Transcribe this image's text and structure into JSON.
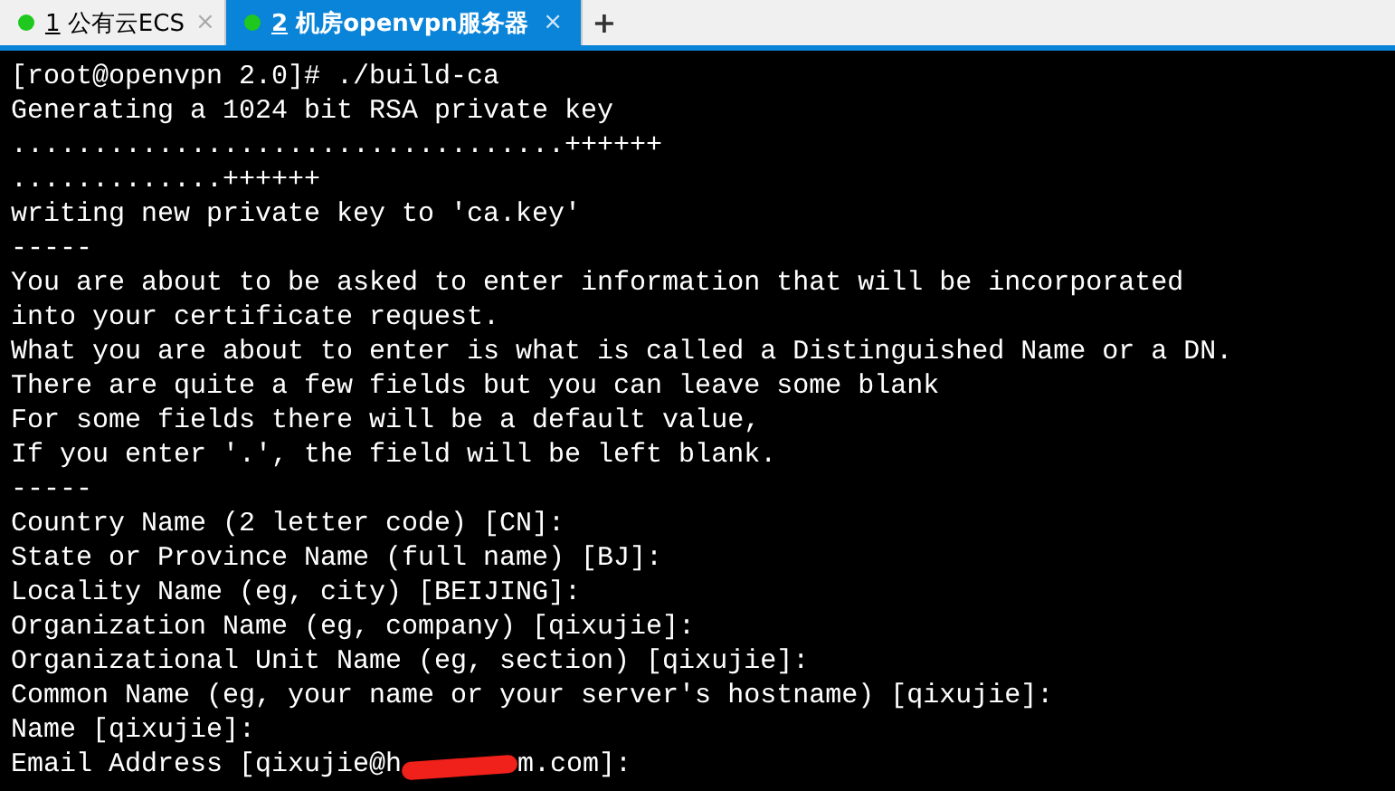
{
  "tabs": [
    {
      "number": "1",
      "label": "公有云ECS",
      "selected": false,
      "close": "×"
    },
    {
      "number": "2",
      "label": "机房openvpn服务器",
      "selected": true,
      "close": "×"
    }
  ],
  "new_tab": "+",
  "terminal": {
    "lines": [
      {
        "kind": "text",
        "text": "[root@openvpn 2.0]# ./build-ca"
      },
      {
        "kind": "text",
        "text": "Generating a 1024 bit RSA private key"
      },
      {
        "kind": "text",
        "text": "..................................++++++"
      },
      {
        "kind": "text",
        "text": ".............++++++"
      },
      {
        "kind": "text",
        "text": "writing new private key to 'ca.key'"
      },
      {
        "kind": "text",
        "text": "-----"
      },
      {
        "kind": "text",
        "text": "You are about to be asked to enter information that will be incorporated"
      },
      {
        "kind": "text",
        "text": "into your certificate request."
      },
      {
        "kind": "text",
        "text": "What you are about to enter is what is called a Distinguished Name or a DN."
      },
      {
        "kind": "text",
        "text": "There are quite a few fields but you can leave some blank"
      },
      {
        "kind": "text",
        "text": "For some fields there will be a default value,"
      },
      {
        "kind": "text",
        "text": "If you enter '.', the field will be left blank."
      },
      {
        "kind": "text",
        "text": "-----"
      },
      {
        "kind": "text",
        "text": "Country Name (2 letter code) [CN]:"
      },
      {
        "kind": "text",
        "text": "State or Province Name (full name) [BJ]:"
      },
      {
        "kind": "text",
        "text": "Locality Name (eg, city) [BEIJING]:"
      },
      {
        "kind": "text",
        "text": "Organization Name (eg, company) [qixujie]:"
      },
      {
        "kind": "text",
        "text": "Organizational Unit Name (eg, section) [qixujie]:"
      },
      {
        "kind": "text",
        "text": "Common Name (eg, your name or your server's hostname) [qixujie]:"
      },
      {
        "kind": "text",
        "text": "Name [qixujie]:"
      },
      {
        "kind": "redacted",
        "before": "Email Address [qixujie@h",
        "after": "m.com]:"
      }
    ]
  }
}
